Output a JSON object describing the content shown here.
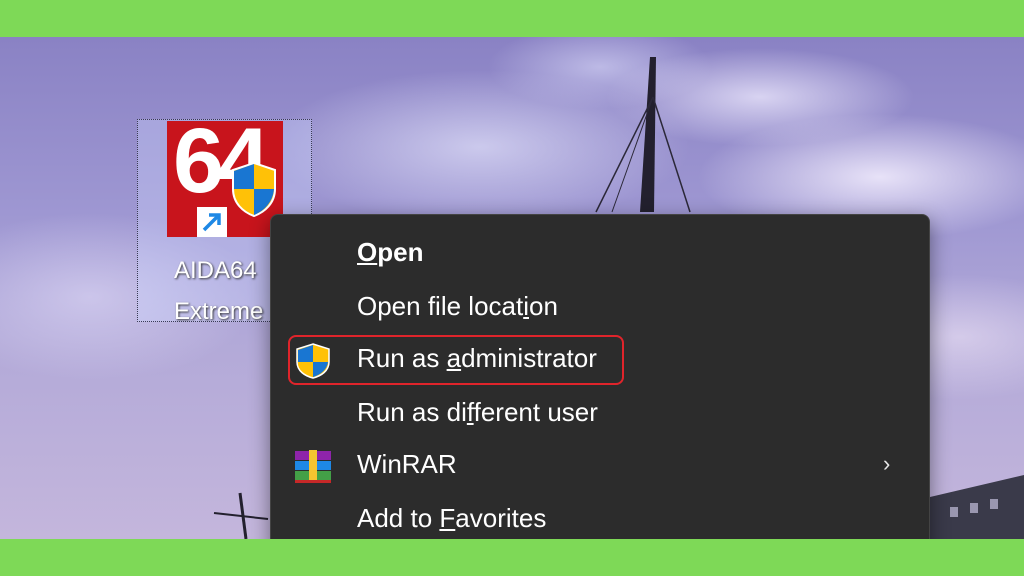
{
  "desktop": {
    "shortcut": {
      "tile_text": "64",
      "label_line1": "AIDA64",
      "label_line2": "Extreme",
      "icon": "aida64-app-icon",
      "badges": [
        "shortcut-arrow-icon",
        "uac-shield-icon"
      ]
    }
  },
  "context_menu": {
    "items": [
      {
        "label": "Open",
        "icon": null,
        "emphasis": "bold",
        "access_key": "O"
      },
      {
        "label": "Open file location",
        "icon": null,
        "access_key": "i"
      },
      {
        "label": "Run as administrator",
        "icon": "uac-shield-icon",
        "access_key": "a",
        "highlighted": true
      },
      {
        "label": "Run as different user",
        "icon": null,
        "access_key": "f"
      },
      {
        "label": "WinRAR",
        "icon": "winrar-icon",
        "submenu": true,
        "chevron": "›"
      },
      {
        "label": "Add to Favorites",
        "icon": null,
        "access_key": "F"
      }
    ]
  },
  "colors": {
    "frame_green": "#7ed957",
    "menu_bg": "#2c2c2c",
    "highlight_red": "#e0242b",
    "app_tile_red": "#c8141c",
    "shortcut_arrow_blue": "#1e88e5"
  }
}
